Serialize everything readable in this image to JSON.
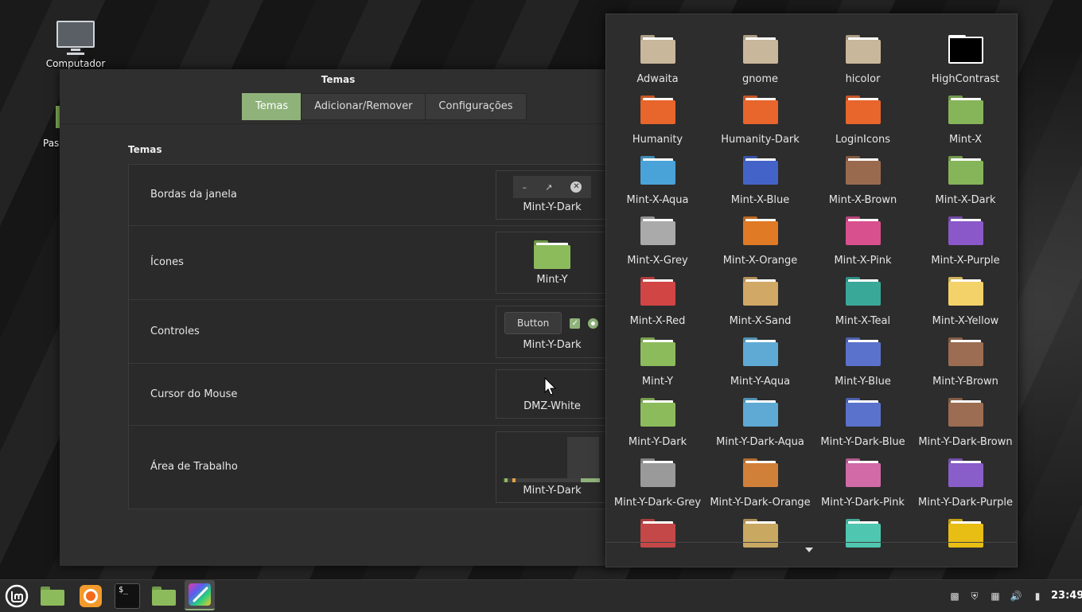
{
  "desktop": {
    "icons": [
      {
        "label": "Computador"
      },
      {
        "label": "Pas"
      }
    ]
  },
  "window": {
    "title": "Temas",
    "tabs": [
      {
        "label": "Temas",
        "active": true
      },
      {
        "label": "Adicionar/Remover",
        "active": false
      },
      {
        "label": "Configurações",
        "active": false
      }
    ],
    "section_title": "Temas",
    "rows": [
      {
        "label": "Bordas da janela",
        "value": "Mint-Y-Dark"
      },
      {
        "label": "Ícones",
        "value": "Mint-Y"
      },
      {
        "label": "Controles",
        "value": "Mint-Y-Dark",
        "button_label": "Button"
      },
      {
        "label": "Cursor do Mouse",
        "value": "DMZ-White"
      },
      {
        "label": "Área de Trabalho",
        "value": "Mint-Y-Dark"
      }
    ]
  },
  "icon_chooser": {
    "items": [
      {
        "label": "Adwaita",
        "color": "#c9b79c"
      },
      {
        "label": "gnome",
        "color": "#c9b79c"
      },
      {
        "label": "hicolor",
        "color": "#c9b79c"
      },
      {
        "label": "HighContrast",
        "color": "#000000"
      },
      {
        "label": "Humanity",
        "color": "#e8652b"
      },
      {
        "label": "Humanity-Dark",
        "color": "#e8652b"
      },
      {
        "label": "LoginIcons",
        "color": "#e8652b"
      },
      {
        "label": "Mint-X",
        "color": "#86b559"
      },
      {
        "label": "Mint-X-Aqua",
        "color": "#4aa3d8"
      },
      {
        "label": "Mint-X-Blue",
        "color": "#4463c8"
      },
      {
        "label": "Mint-X-Brown",
        "color": "#9a6a4e"
      },
      {
        "label": "Mint-X-Dark",
        "color": "#86b559"
      },
      {
        "label": "Mint-X-Grey",
        "color": "#aaaaaa"
      },
      {
        "label": "Mint-X-Orange",
        "color": "#e07a25"
      },
      {
        "label": "Mint-X-Pink",
        "color": "#d9508f"
      },
      {
        "label": "Mint-X-Purple",
        "color": "#8a58c9"
      },
      {
        "label": "Mint-X-Red",
        "color": "#d24545"
      },
      {
        "label": "Mint-X-Sand",
        "color": "#d1a866"
      },
      {
        "label": "Mint-X-Teal",
        "color": "#3aa899"
      },
      {
        "label": "Mint-X-Yellow",
        "color": "#f4d26a"
      },
      {
        "label": "Mint-Y",
        "color": "#8cbb5c"
      },
      {
        "label": "Mint-Y-Aqua",
        "color": "#5eaad4"
      },
      {
        "label": "Mint-Y-Blue",
        "color": "#5b72cc"
      },
      {
        "label": "Mint-Y-Brown",
        "color": "#9c6d52"
      },
      {
        "label": "Mint-Y-Dark",
        "color": "#8cbb5c"
      },
      {
        "label": "Mint-Y-Dark-Aqua",
        "color": "#5eaad4"
      },
      {
        "label": "Mint-Y-Dark-Blue",
        "color": "#5b72cc"
      },
      {
        "label": "Mint-Y-Dark-Brown",
        "color": "#9c6d52"
      },
      {
        "label": "Mint-Y-Dark-Grey",
        "color": "#9a9a9a"
      },
      {
        "label": "Mint-Y-Dark-Orange",
        "color": "#d1803a"
      },
      {
        "label": "Mint-Y-Dark-Pink",
        "color": "#d16aa7"
      },
      {
        "label": "Mint-Y-Dark-Purple",
        "color": "#8a5ec9"
      },
      {
        "label": "",
        "color": "#c54848"
      },
      {
        "label": "",
        "color": "#c9a862"
      },
      {
        "label": "",
        "color": "#4fc7b0"
      },
      {
        "label": "",
        "color": "#e8bd14"
      }
    ]
  },
  "taskbar": {
    "clock": "23:49",
    "terminal_prompt": "$_"
  },
  "colors": {
    "accent": "#8fb27a",
    "window_bg": "#2f2f2f",
    "popup_bg": "#2d2d2d"
  }
}
